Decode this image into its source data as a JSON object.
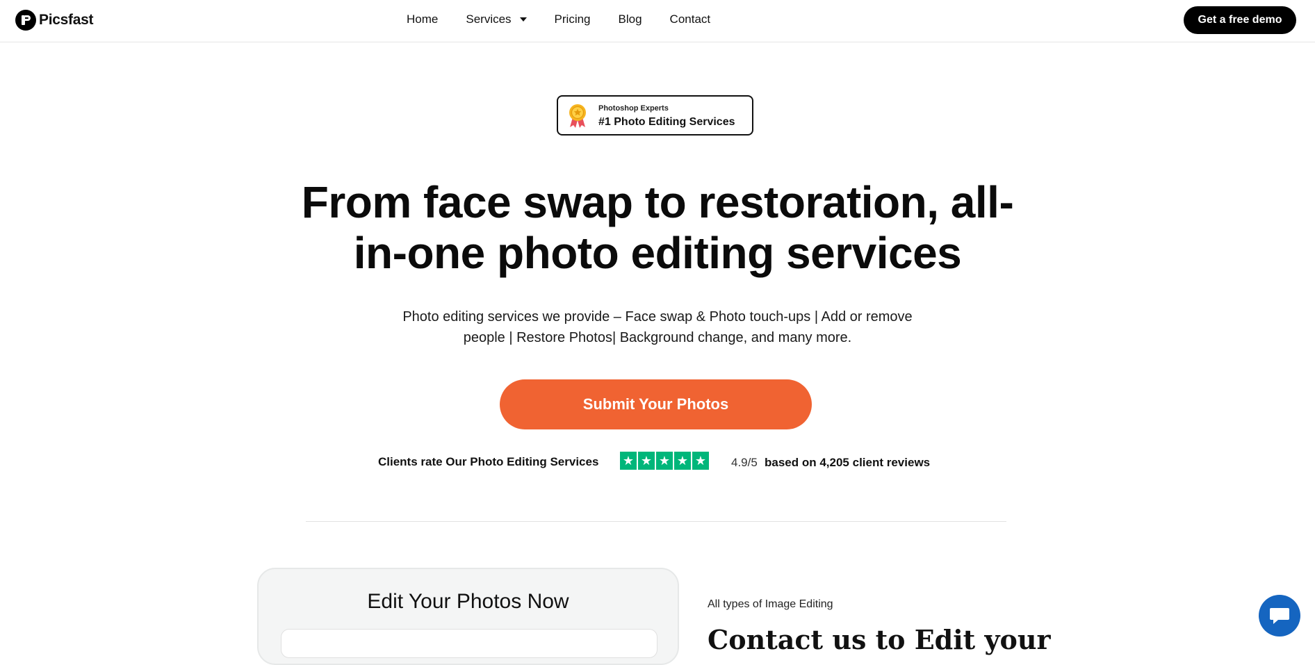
{
  "brand": {
    "name": "Picsfast"
  },
  "nav": {
    "items": [
      {
        "label": "Home"
      },
      {
        "label": "Services",
        "has_dropdown": true
      },
      {
        "label": "Pricing"
      },
      {
        "label": "Blog"
      },
      {
        "label": "Contact"
      }
    ],
    "cta_label": "Get a free demo"
  },
  "badge": {
    "small": "Photoshop Experts",
    "big": "#1 Photo Editing Services",
    "icon": "award-medal-icon"
  },
  "hero": {
    "title_line1": "From face swap to restoration, all-",
    "title_line2": "in-one photo editing services",
    "subtitle_line1": "Photo editing services we provide – Face swap & Photo touch-ups | Add or remove",
    "subtitle_line2": "people | Restore Photos| Background change, and many more.",
    "cta_label": "Submit Your Photos"
  },
  "rating": {
    "label": "Clients rate Our Photo Editing Services",
    "stars": 5,
    "score": "4.9/5",
    "reviews_text": "based on 4,205 client reviews"
  },
  "form": {
    "title": "Edit Your Photos Now"
  },
  "section": {
    "eyebrow": "All types of Image Editing",
    "title_partial": "Contact us to Edit your"
  },
  "chat": {
    "icon": "chat-bubble-icon"
  },
  "colors": {
    "accent": "#f06332",
    "star_green": "#00b67a",
    "chat_blue": "#1565c0",
    "dark": "#000000"
  }
}
